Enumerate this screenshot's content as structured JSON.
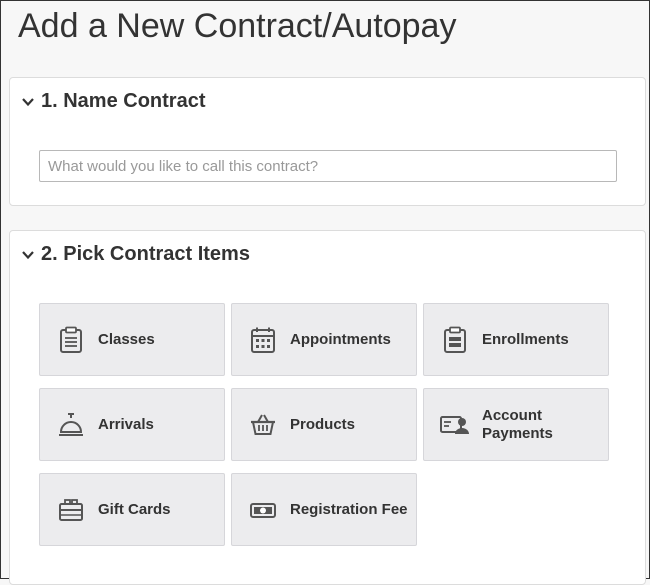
{
  "page": {
    "title": "Add a New Contract/Autopay"
  },
  "sections": [
    {
      "number_title": "1. Name Contract",
      "input": {
        "value": "",
        "placeholder": "What would you like to call this contract?"
      }
    },
    {
      "number_title": "2. Pick Contract Items",
      "items": [
        {
          "label": "Classes",
          "icon": "clipboard-list-icon"
        },
        {
          "label": "Appointments",
          "icon": "calendar-icon"
        },
        {
          "label": "Enrollments",
          "icon": "clipboard-icon"
        },
        {
          "label": "Arrivals",
          "icon": "service-bell-icon"
        },
        {
          "label": "Products",
          "icon": "shopping-basket-icon"
        },
        {
          "label": "Account Payments",
          "icon": "account-card-icon"
        },
        {
          "label": "Gift Cards",
          "icon": "gift-card-icon"
        },
        {
          "label": "Registration Fee",
          "icon": "cash-bill-icon"
        }
      ]
    }
  ],
  "colors": {
    "tile_bg": "#ececee",
    "icon": "#555555",
    "text": "#333333"
  }
}
